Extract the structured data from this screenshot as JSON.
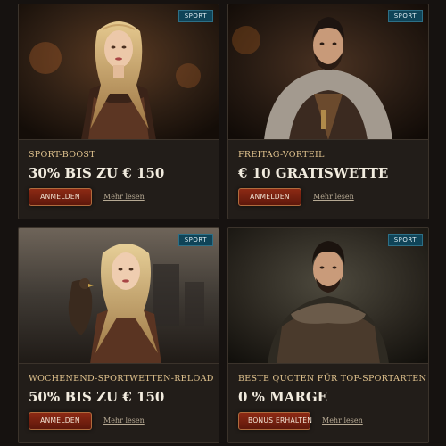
{
  "cards": [
    {
      "badge": "SPORT",
      "title": "SPORT-BOOST",
      "headline": "30% BIS ZU € 150",
      "cta": "ANMELDEN",
      "more": "Mehr lesen",
      "image": "portrait of blonde woman in ornate dress"
    },
    {
      "badge": "SPORT",
      "title": "FREITAG-VORTEIL",
      "headline": "€ 10 GRATISWETTE",
      "cta": "ANMELDEN",
      "more": "Mehr lesen",
      "image": "portrait of bearded man in fur cloak"
    },
    {
      "badge": "SPORT",
      "title": "WOCHENEND-SPORTWETTEN-RELOAD",
      "headline": "50% BIS ZU € 150",
      "cta": "ANMELDEN",
      "more": "Mehr lesen",
      "image": "portrait of woman with falcon"
    },
    {
      "badge": "SPORT",
      "title": "BESTE QUOTEN FÜR TOP-SPORTARTEN",
      "headline": "0 % MARGE",
      "cta": "BONUS ERHALTEN",
      "more": "Mehr lesen",
      "image": "portrait of man in fur-trimmed cloak"
    }
  ],
  "colors": {
    "page_bg": "#161210",
    "card_bg": "#221d19",
    "badge_bg": "#0f4458",
    "title": "#e2c48f",
    "headline": "#f2ecdf",
    "cta_bg": "#7a2412"
  }
}
